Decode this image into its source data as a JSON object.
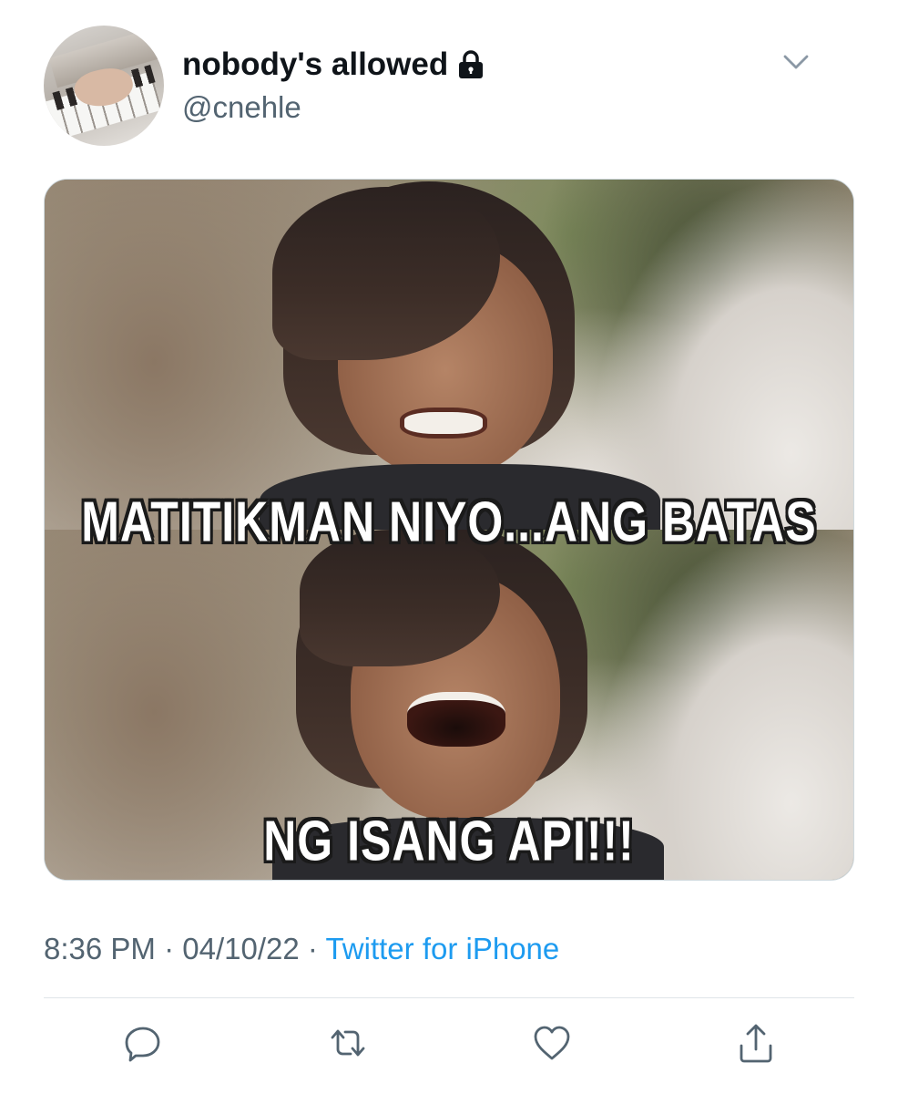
{
  "tweet": {
    "display_name": "nobody's allowed",
    "handle": "@cnehle",
    "avatar_icon": "avatar-piano-photo",
    "lock_icon": "lock-icon",
    "more_icon": "chevron-down-icon"
  },
  "media": {
    "caption_top": "MATITIKMAN NIYO...ANG BATAS",
    "caption_bottom": "NG ISANG API!!!"
  },
  "meta": {
    "time": "8:36 PM",
    "separator": "·",
    "date": "04/10/22",
    "source": "Twitter for iPhone"
  },
  "actions": [
    {
      "name": "reply",
      "icon": "reply-icon"
    },
    {
      "name": "retweet",
      "icon": "retweet-icon"
    },
    {
      "name": "like",
      "icon": "heart-icon"
    },
    {
      "name": "share",
      "icon": "share-icon"
    }
  ],
  "colors": {
    "text_primary": "#0f1419",
    "text_secondary": "#536471",
    "link": "#1d9bf0",
    "divider": "#dfe5e9"
  }
}
